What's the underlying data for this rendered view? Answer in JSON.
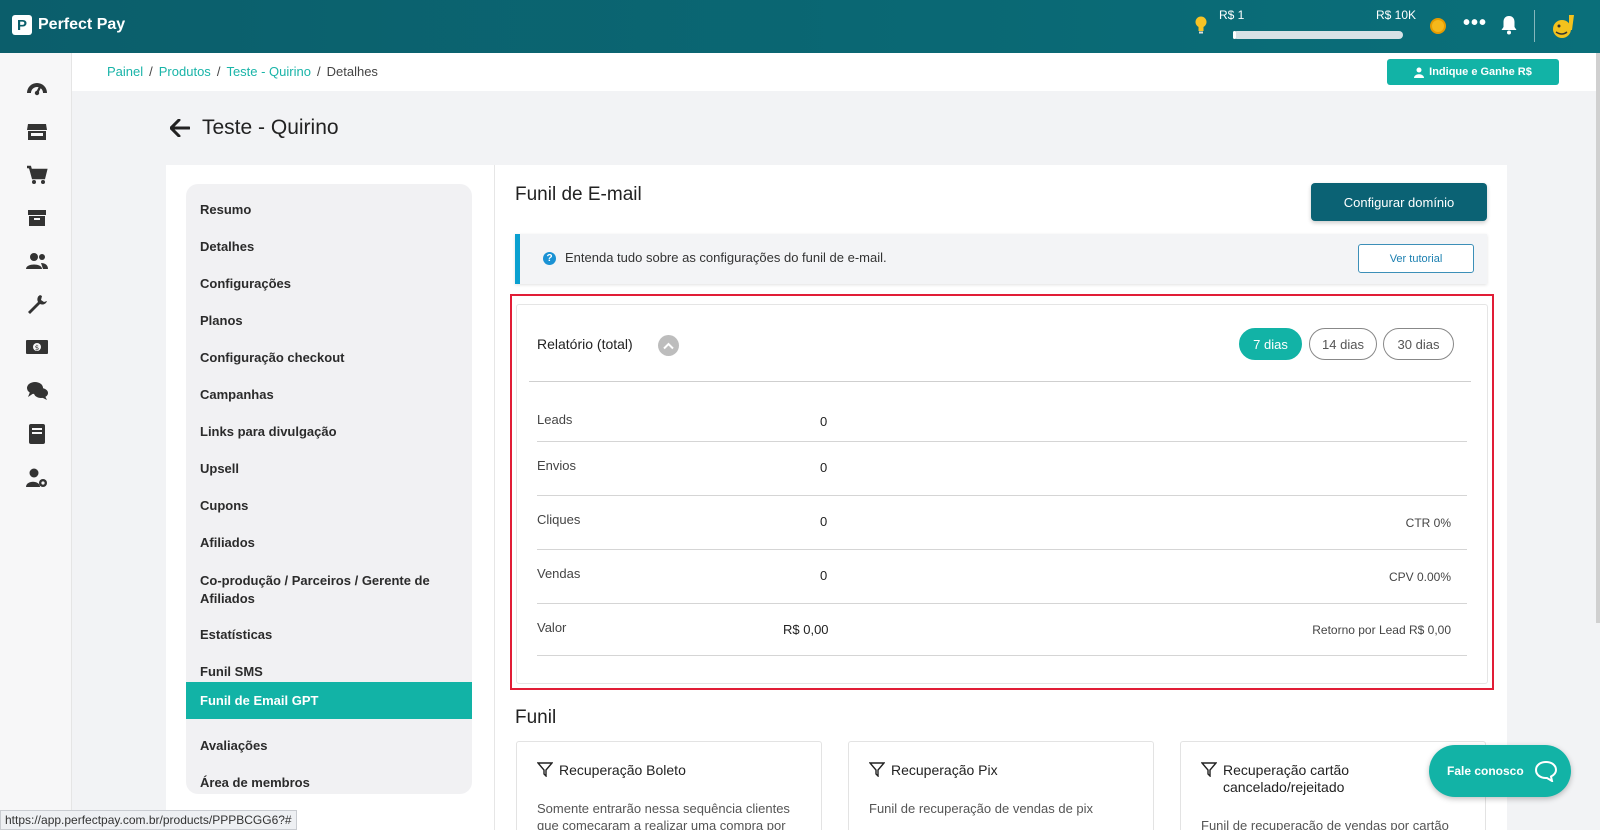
{
  "topbar": {
    "brand": "Perfect Pay",
    "range_min": "R$ 1",
    "range_max": "R$ 10K",
    "progress_fraction": 0.02
  },
  "breadcrumb": {
    "items": [
      "Painel",
      "Produtos",
      "Teste - Quirino"
    ],
    "current": "Detalhes",
    "separator": "/"
  },
  "refer_button": "Indique e Ganhe R$",
  "page": {
    "title": "Teste - Quirino"
  },
  "submenu": {
    "items": [
      "Resumo",
      "Detalhes",
      "Configurações",
      "Planos",
      "Configuração checkout",
      "Campanhas",
      "Links para divulgação",
      "Upsell",
      "Cupons",
      "Afiliados",
      "Co-produção / Parceiros / Gerente de Afiliados",
      "Estatísticas",
      "Funil SMS",
      "Funil de Email GPT",
      "Avaliações",
      "Área de membros"
    ],
    "active": "Funil de Email GPT"
  },
  "section": {
    "title": "Funil de E-mail",
    "config_button": "Configurar domínio",
    "info_text": "Entenda tudo sobre as configurações do funil de e-mail.",
    "tutorial_button": "Ver tutorial"
  },
  "report": {
    "title": "Relatório (total)",
    "periods": [
      "7 dias",
      "14 dias",
      "30 dias"
    ],
    "active_period": "7 dias",
    "rows": [
      {
        "label": "Leads",
        "value": "0",
        "extra": ""
      },
      {
        "label": "Envios",
        "value": "0",
        "extra": ""
      },
      {
        "label": "Cliques",
        "value": "0",
        "extra": "CTR 0%"
      },
      {
        "label": "Vendas",
        "value": "0",
        "extra": "CPV 0.00%"
      },
      {
        "label": "Valor",
        "value": "R$ 0,00",
        "extra": "Retorno por Lead R$ 0,00"
      }
    ]
  },
  "funnel": {
    "title": "Funil",
    "cards": [
      {
        "title": "Recuperação Boleto",
        "desc": "Somente entrarão nessa sequência clientes que começaram a realizar uma compra por"
      },
      {
        "title": "Recuperação Pix",
        "desc": "Funil de recuperação de vendas de pix"
      },
      {
        "title": "Recuperação cartão cancelado/rejeitado",
        "desc": "Funil de recuperação de vendas por cartão"
      }
    ]
  },
  "chat_button": "Fale conosco",
  "status_url": "https://app.perfectpay.com.br/products/PPPBCGG6?#",
  "colors": {
    "topbar": "#0b5e6b",
    "accent": "#12b3a6",
    "primary_button": "#0b6274",
    "highlight_outline": "#e11d36",
    "info_border": "#0aa0d0"
  }
}
